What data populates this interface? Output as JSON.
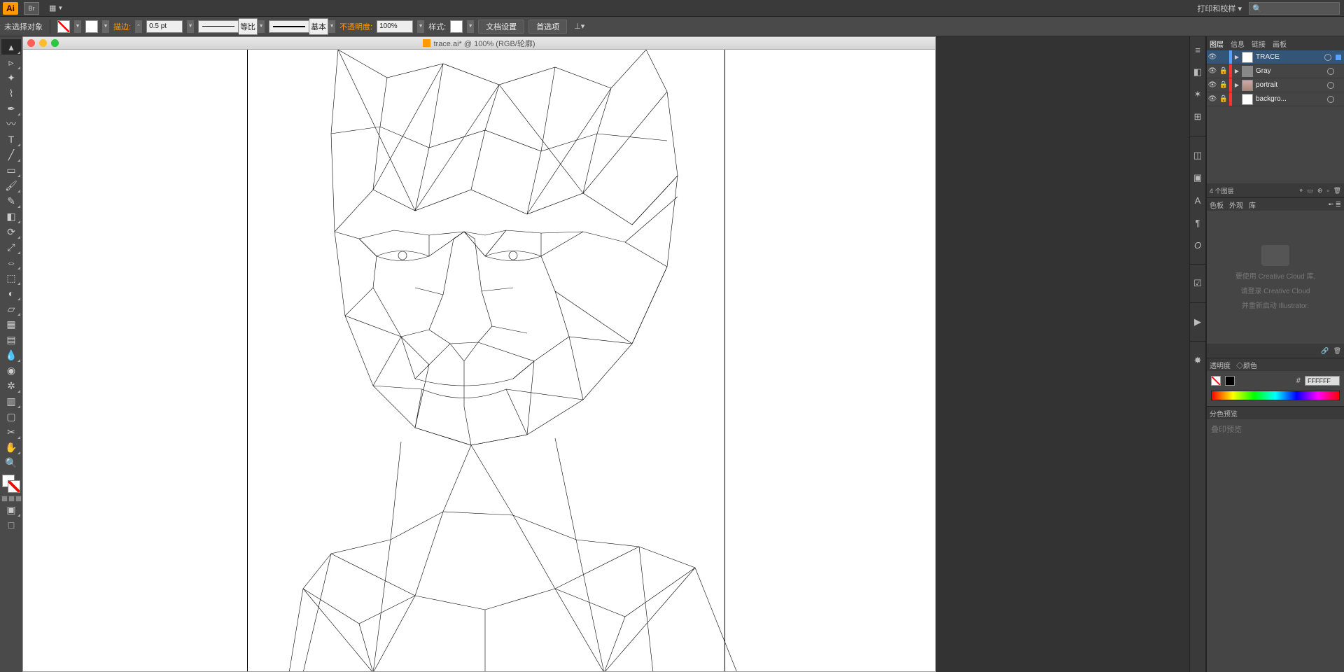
{
  "topbar": {
    "logo": "Ai",
    "bridge": "Br",
    "workspace": "打印和校样",
    "search_placeholder": ""
  },
  "controlbar": {
    "selection_status": "未选择对象",
    "stroke_label": "描边:",
    "stroke_weight": "0.5 pt",
    "stroke_profile": "等比",
    "stroke_style": "基本",
    "opacity_label": "不透明度:",
    "opacity_value": "100%",
    "style_label": "样式:",
    "doc_setup": "文档设置",
    "preferences": "首选项"
  },
  "document": {
    "title": "trace.ai* @ 100% (RGB/轮廓)"
  },
  "layers_panel": {
    "tabs": [
      "图层",
      "信息",
      "链接",
      "画板"
    ],
    "rows": [
      {
        "name": "TRACE",
        "thumb": "white",
        "color": "#5aa0ff",
        "selected": true
      },
      {
        "name": "Gray",
        "thumb": "gray",
        "color": "#ff3333",
        "locked": true
      },
      {
        "name": "portrait",
        "thumb": "port",
        "color": "#ff3333",
        "locked": true
      },
      {
        "name": "backgro...",
        "thumb": "white",
        "color": "#ff3333",
        "locked": true
      }
    ],
    "footer": "4 个图层"
  },
  "swatch_panel": {
    "tabs": [
      "色板",
      "外观",
      "库"
    ]
  },
  "lib_panel": {
    "line1": "要使用 Creative Cloud 库,",
    "line2": "请登录 Creative Cloud",
    "line3": "并重新启动 Illustrator."
  },
  "color_panel": {
    "tabs": [
      "透明度",
      "◇颜色"
    ],
    "hash": "#",
    "hex": "FFFFFF"
  },
  "sep_panel": {
    "tab": "分色预览",
    "line": "叠印预览"
  }
}
